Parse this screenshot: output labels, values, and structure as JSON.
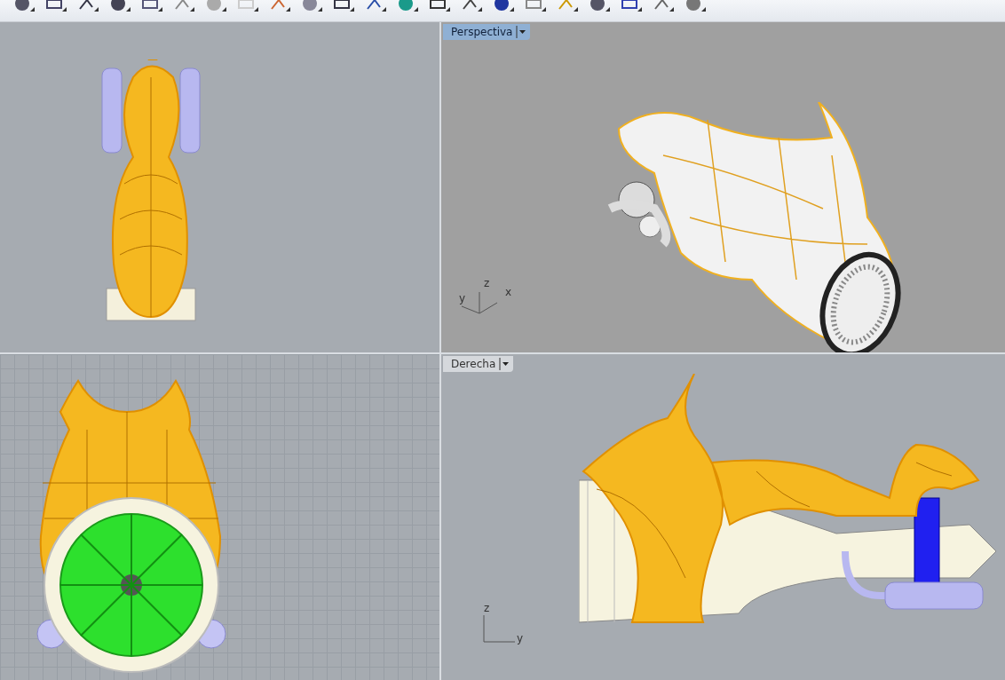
{
  "viewports": [
    {
      "kind": "top",
      "grid": false
    },
    {
      "kind": "perspective",
      "title": "Perspectiva",
      "selected": true,
      "grid": false,
      "axes": [
        "z",
        "y",
        "x"
      ]
    },
    {
      "kind": "front",
      "grid": true
    },
    {
      "kind": "right",
      "title": "Derecha",
      "selected": false,
      "grid": false,
      "axes": [
        "z",
        "y"
      ]
    }
  ]
}
